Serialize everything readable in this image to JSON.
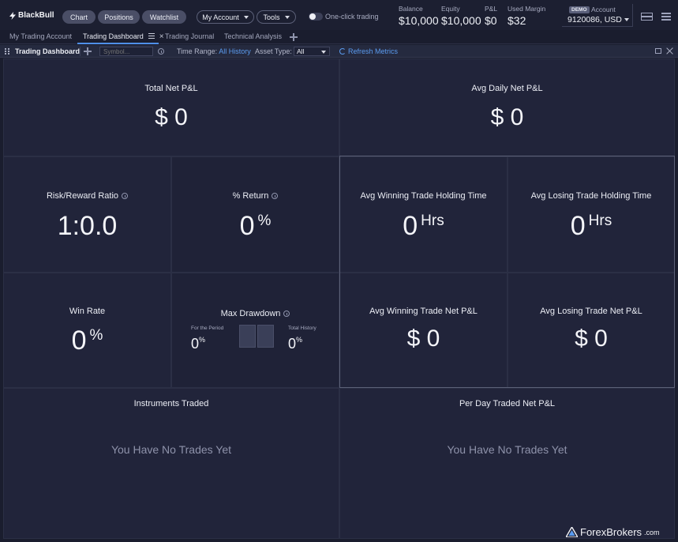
{
  "app": {
    "logo": "BlackBull"
  },
  "topbar": {
    "nav_pills": [
      "Chart",
      "Positions",
      "Watchlist"
    ],
    "my_account": "My Account",
    "tools": "Tools",
    "one_click": "One-click trading",
    "stats": [
      {
        "label": "Balance",
        "value": "$10,000"
      },
      {
        "label": "Equity",
        "value": "$10,000"
      },
      {
        "label": "P&L",
        "value": "$0"
      },
      {
        "label": "Used Margin",
        "value": "$32"
      }
    ],
    "account": {
      "badge": "DEMO",
      "label": "Account",
      "value": "9120086, USD"
    }
  },
  "tabs": [
    {
      "label": "My Trading Account",
      "active": false
    },
    {
      "label": "Trading Dashboard",
      "active": true
    },
    {
      "label": "Trading Journal",
      "active": false
    },
    {
      "label": "Technical Analysis",
      "active": false
    }
  ],
  "toolbar": {
    "title": "Trading Dashboard",
    "symbol_placeholder": "Symbol...",
    "time_range_label": "Time Range:",
    "time_range_value": "All History",
    "asset_type_label": "Asset Type:",
    "asset_type_value": "All",
    "refresh": "Refresh Metrics"
  },
  "metrics": {
    "total_net_pnl": {
      "title": "Total Net P&L",
      "value": "$ 0"
    },
    "avg_daily_net_pnl": {
      "title": "Avg Daily Net P&L",
      "value": "$ 0"
    },
    "risk_reward": {
      "title": "Risk/Reward Ratio",
      "value": "1:0.0"
    },
    "pct_return": {
      "title": "% Return",
      "value": "0",
      "unit": "%"
    },
    "avg_win_hold": {
      "title": "Avg Winning Trade Holding Time",
      "value": "0",
      "unit": "Hrs"
    },
    "avg_loss_hold": {
      "title": "Avg Losing Trade Holding Time",
      "value": "0",
      "unit": "Hrs"
    },
    "win_rate": {
      "title": "Win Rate",
      "value": "0",
      "unit": "%"
    },
    "max_drawdown": {
      "title": "Max Drawdown",
      "period_label": "For the Period",
      "period_value": "0",
      "history_label": "Total History",
      "history_value": "0",
      "unit": "%"
    },
    "avg_win_pnl": {
      "title": "Avg Winning Trade Net P&L",
      "value": "$ 0"
    },
    "avg_loss_pnl": {
      "title": "Avg Losing Trade Net P&L",
      "value": "$ 0"
    }
  },
  "instruments": {
    "title": "Instruments Traded",
    "empty": "You Have No Trades Yet"
  },
  "per_day": {
    "title": "Per Day Traded Net P&L",
    "empty": "You Have No Trades Yet"
  },
  "watermark": {
    "brand": "ForexBrokers",
    "suffix": ".com"
  },
  "colors": {
    "accent": "#5b9cf0",
    "background": "#1a1d2e",
    "panel": "#21243a"
  }
}
